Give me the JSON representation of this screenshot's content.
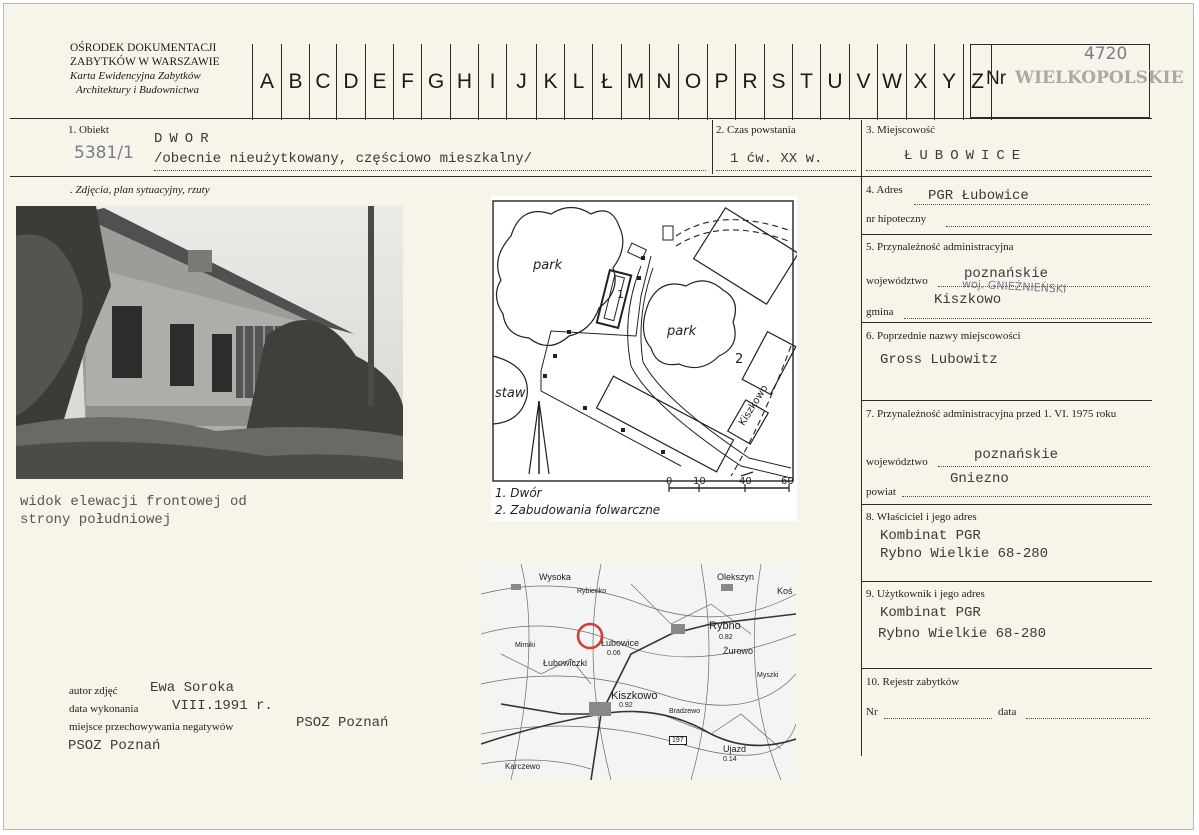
{
  "header": {
    "institution_lines": [
      "OŚRODEK DOKUMENTACJI",
      "ZABYTKÓW W WARSZAWIE",
      "Karta Ewidencyjna Zabytków",
      "Architektury i Budownictwa"
    ],
    "letters": [
      "A",
      "B",
      "C",
      "D",
      "E",
      "F",
      "G",
      "H",
      "I",
      "J",
      "K",
      "L",
      "Ł",
      "M",
      "N",
      "O",
      "P",
      "R",
      "S",
      "T",
      "U",
      "V",
      "W",
      "X",
      "Y",
      "Z"
    ],
    "nr_label": "Nr",
    "nr_stamp": "WIELKOPOLSKIE",
    "nr_handwritten": "4720"
  },
  "fields": {
    "obiekt_label": "1. Obiekt",
    "obiekt_value": "DWOR",
    "obiekt_desc": "/obecnie nieużytkowany, częściowo mieszkalny/",
    "obiekt_hand": "5381/1",
    "czas_label": "2. Czas powstania",
    "czas_value": "1 ćw. XX w.",
    "miejscowosc_label": "3. Miejscowość",
    "miejscowosc_value": "ŁUBOWICE",
    "photos_label": ". Zdjęcia, plan sytuacyjny, rzuty",
    "adres_label": "4. Adres",
    "adres_value": "PGR Łubowice",
    "hipoteczny_label": "nr hipoteczny",
    "przyn_label": "5. Przynależność administracyjna",
    "wojewodztwo_label": "województwo",
    "wojewodztwo_value": "poznańskie",
    "wojewodztwo_hand": "woj. GNIEŹNIEŃSKI",
    "gmina_label": "gmina",
    "gmina_value": "Kiszkowo",
    "poprzednie_label": "6. Poprzednie nazwy miejscowości",
    "poprzednie_value": "Gross Lubowitz",
    "przyn1975_label": "7. Przynależność administracyjna przed 1. VI. 1975 roku",
    "woj1975_label": "województwo",
    "woj1975_value": "poznańskie",
    "powiat_label": "powiat",
    "powiat_value": "Gniezno",
    "wlasciciel_label": "8. Właściciel i jego adres",
    "wlasciciel_line1": "Kombinat PGR",
    "wlasciciel_line2": "Rybno Wielkie 68-280",
    "uzytkownik_label": "9. Użytkownik i jego adres",
    "uzytkownik_line1": "Kombinat PGR",
    "uzytkownik_line2": "Rybno Wielkie 68-280",
    "rejestr_label": "10. Rejestr zabytków",
    "nr_label": "Nr",
    "data_label": "data"
  },
  "photo": {
    "caption_line1": "widok elewacji frontowej od",
    "caption_line2": "strony południowej"
  },
  "plan": {
    "label_park1": "park",
    "label_park2": "park",
    "label_staw": "staw",
    "label_1": "1",
    "label_2": "2",
    "label_road": "Kiszkowo",
    "legend1": "1. Dwór",
    "legend2": "2. Zabudowania folwarczne",
    "scale": [
      "0",
      "10",
      "40",
      "60"
    ]
  },
  "map": {
    "labels": [
      "Wysoka",
      "Rybienko",
      "Olekszyn",
      "Koś",
      "Łubowice",
      "Rybno",
      "Żurowo",
      "Łubowiczki",
      "Kiszkowo",
      "Myszki",
      "Bradzewo",
      "Ujazd",
      "Karczewo",
      "Mirniki",
      "0.06",
      "0.82",
      "0.92",
      "0.14",
      "197"
    ]
  },
  "footer": {
    "autor_label": "autor zdjęć",
    "autor_value": "Ewa Soroka",
    "data_label": "data wykonania",
    "data_value": "VIII.1991 r.",
    "miejsce_label": "miejsce przechowywania negatywów",
    "miejsce_value": "PSOZ Poznań",
    "miejsce_value2": "PSOZ Poznań"
  }
}
